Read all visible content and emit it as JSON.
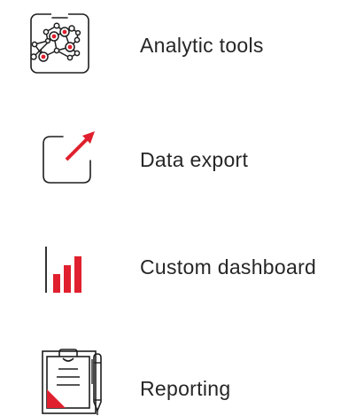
{
  "features": [
    {
      "label": "Analytic tools",
      "icon": "analytics-network-icon"
    },
    {
      "label": "Data export",
      "icon": "export-arrow-icon"
    },
    {
      "label": "Custom dashboard",
      "icon": "bar-chart-icon"
    },
    {
      "label": "Reporting",
      "icon": "report-clipboard-icon"
    }
  ],
  "colors": {
    "accent": "#e0202e",
    "line": "#1e1e1e",
    "text": "#262626",
    "background": "#ffffff"
  }
}
